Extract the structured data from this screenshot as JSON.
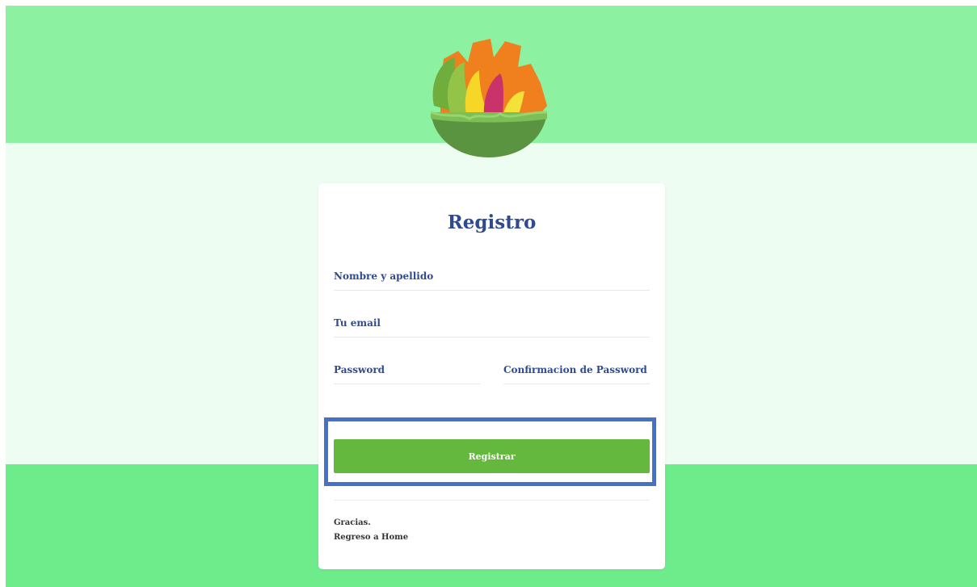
{
  "colors": {
    "top_band": "#8cf2a1",
    "middle_band": "#eefdf1",
    "bottom_band": "#6eec8b",
    "title_text": "#304a8f",
    "button": "#64b83d",
    "highlight_box": "#4472c4"
  },
  "logo": {
    "icon": "fruit-bowl-logo"
  },
  "form": {
    "title": "Registro",
    "fields": {
      "name": {
        "label": "Nombre y apellido",
        "value": ""
      },
      "email": {
        "label": "Tu email",
        "value": ""
      },
      "password": {
        "label": "Password",
        "value": ""
      },
      "confirm": {
        "label": "Confirmacion de Password",
        "value": ""
      }
    },
    "submit_label": "Registrar"
  },
  "footer": {
    "thanks": "Gracias.",
    "home_link": "Regreso a Home"
  }
}
